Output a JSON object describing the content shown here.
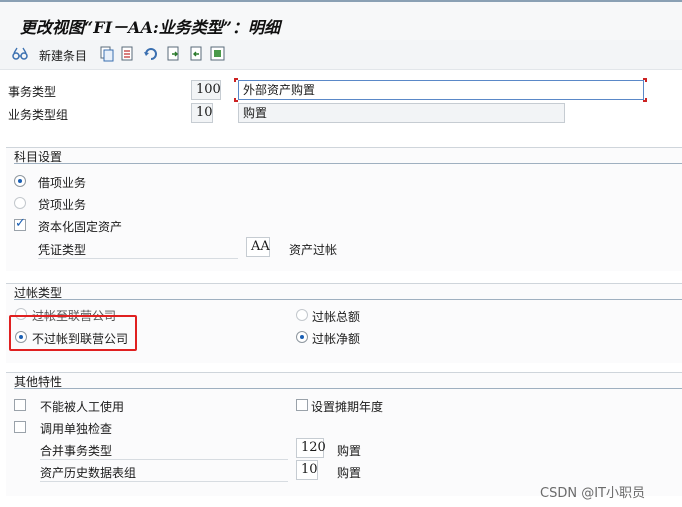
{
  "title": "更改视图“FI－AA:业务类型”：明细",
  "toolbar": {
    "new_entries_label": "新建条目",
    "icons": [
      "glasses-icon",
      "copy-icon",
      "delete-icon",
      "undo-icon",
      "select-all-icon",
      "deselect-icon",
      "block-icon"
    ]
  },
  "header": {
    "trans_type_label": "事务类型",
    "trans_type_value": "100",
    "trans_type_desc": "外部资产购置",
    "group_label": "业务类型组",
    "group_value": "10",
    "group_desc": "购置"
  },
  "account_settings": {
    "title": "科目设置",
    "debit_label": "借项业务",
    "credit_label": "贷项业务",
    "capitalize_label": "资本化固定资产",
    "doc_type_label": "凭证类型",
    "doc_type_value": "AA",
    "doc_type_desc": "资产过帐",
    "debit_selected": true,
    "capitalize_checked": true
  },
  "posting_type": {
    "title": "过帐类型",
    "to_affiliated_label": "过帐至联营公司",
    "not_to_affiliated_label": "不过帐到联营公司",
    "gross_label": "过帐总额",
    "net_label": "过帐净额"
  },
  "other": {
    "title": "其他特性",
    "manual_label": "不能被人工使用",
    "fiscal_year_label": "设置摊期年度",
    "separate_check_label": "调用单独检查",
    "consolidation_label": "合并事务类型",
    "consolidation_value": "120",
    "consolidation_desc": "购置",
    "history_label": "资产历史数据表组",
    "history_value": "10",
    "history_desc": "购置"
  },
  "watermark": "CSDN @IT小职员",
  "colors": {
    "highlight": "#e02020",
    "accent": "#1a5fb4"
  }
}
